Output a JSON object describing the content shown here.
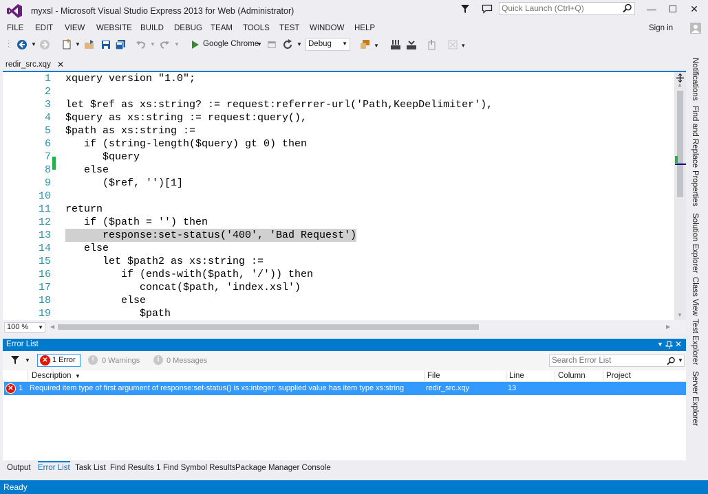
{
  "window": {
    "title": "myxsl - Microsoft Visual Studio Express 2013 for Web (Administrator)",
    "quick_launch_placeholder": "Quick Launch (Ctrl+Q)",
    "minimize": "—",
    "maximize": "☐",
    "close": "✕",
    "sign_in": "Sign in"
  },
  "menu": [
    "FILE",
    "EDIT",
    "VIEW",
    "WEBSITE",
    "BUILD",
    "DEBUG",
    "TEAM",
    "TOOLS",
    "TEST",
    "WINDOW",
    "HELP"
  ],
  "toolbar": {
    "run_target": "Google Chrome",
    "configuration": "Debug"
  },
  "document_tab": {
    "label": "redir_src.xqy",
    "close": "✕"
  },
  "editor": {
    "zoom": "100 %",
    "lines": [
      {
        "n": "1",
        "text": "xquery version \"1.0\";"
      },
      {
        "n": "2",
        "text": ""
      },
      {
        "n": "3",
        "text": "let $ref as xs:string? := request:referrer-url('Path,KeepDelimiter'),"
      },
      {
        "n": "4",
        "text": "$query as xs:string := request:query(),"
      },
      {
        "n": "5",
        "text": "$path as xs:string :="
      },
      {
        "n": "6",
        "text": "   if (string-length($query) gt 0) then"
      },
      {
        "n": "7",
        "text": "      $query"
      },
      {
        "n": "8",
        "text": "   else"
      },
      {
        "n": "9",
        "text": "      ($ref, '')[1]"
      },
      {
        "n": "10",
        "text": ""
      },
      {
        "n": "11",
        "text": "return"
      },
      {
        "n": "12",
        "text": "   if ($path = '') then"
      },
      {
        "n": "13",
        "text": "      response:set-status('400', 'Bad Request')"
      },
      {
        "n": "14",
        "text": "   else"
      },
      {
        "n": "15",
        "text": "      let $path2 as xs:string :="
      },
      {
        "n": "16",
        "text": "         if (ends-with($path, '/')) then"
      },
      {
        "n": "17",
        "text": "            concat($path, 'index.xsl')"
      },
      {
        "n": "18",
        "text": "         else"
      },
      {
        "n": "19",
        "text": "            $path"
      }
    ]
  },
  "error_list": {
    "title": "Error List",
    "errors_btn": "1 Error",
    "warnings_btn": "0 Warnings",
    "messages_btn": "0 Messages",
    "search_placeholder": "Search Error List",
    "columns": {
      "description": "Description",
      "file": "File",
      "line": "Line",
      "column": "Column",
      "project": "Project"
    },
    "rows": [
      {
        "index": "1",
        "description": "Required item type of first argument of response:set-status() is xs:integer; supplied value has item type xs:string",
        "file": "redir_src.xqy",
        "line": "13",
        "column": "",
        "project": ""
      }
    ]
  },
  "bottom_tabs": [
    "Output",
    "Error List",
    "Task List",
    "Find Results 1",
    "Find Symbol Results",
    "Package Manager Console"
  ],
  "right_tabs": [
    "Notifications",
    "Find and Replace",
    "Properties",
    "Solution Explorer",
    "Class View",
    "Test Explorer",
    "Server Explorer"
  ],
  "status": "Ready",
  "colors": {
    "accent": "#007acc",
    "selection": "#3399ff",
    "line_number": "#2b91af",
    "error": "#e51400"
  }
}
